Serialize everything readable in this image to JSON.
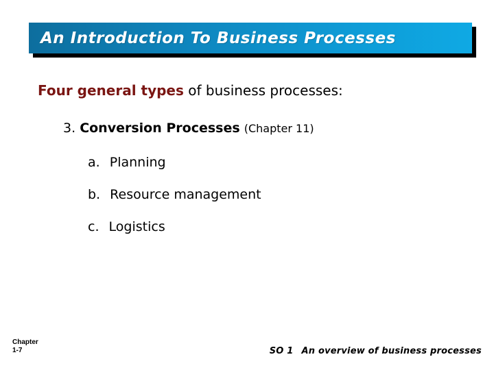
{
  "slide": {
    "title": "An Introduction To Business Processes",
    "title_bar_gradient_start": "#0d6e9e",
    "title_bar_gradient_end": "#0fa9e4",
    "background_color": "#ffffff"
  },
  "content": {
    "lead": {
      "emphasis": "Four general types",
      "emphasis_color": "#7a1512",
      "rest": " of business processes:"
    },
    "numbered_item": {
      "marker": "3.",
      "title": "Conversion Processes",
      "reference": "(Chapter 11)"
    },
    "sub_items": [
      {
        "marker": "a.",
        "label": "Planning"
      },
      {
        "marker": "b.",
        "label": "Resource management"
      },
      {
        "marker": "c.",
        "label": "Logistics"
      }
    ]
  },
  "footer": {
    "chapter_label": "Chapter",
    "chapter_number": "1-7",
    "objective": "SO 1",
    "objective_text": "An overview of business processes"
  }
}
